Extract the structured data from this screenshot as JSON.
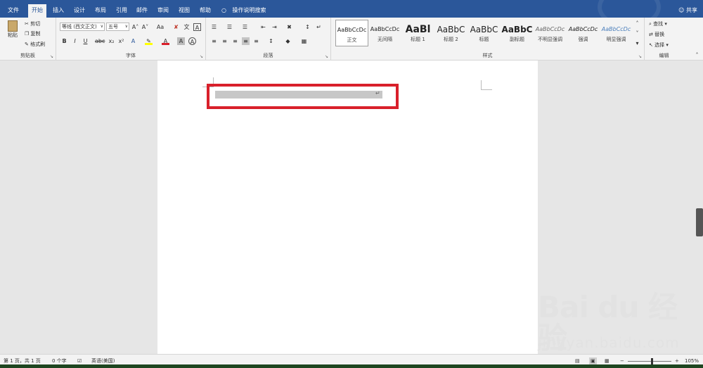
{
  "tabs": [
    "文件",
    "开始",
    "插入",
    "设计",
    "布局",
    "引用",
    "邮件",
    "审阅",
    "视图",
    "帮助"
  ],
  "active_tab": "开始",
  "tellme": "操作说明搜索",
  "share": "共享",
  "clipboard": {
    "paste": "粘贴",
    "cut": "剪切",
    "copy": "复制",
    "format_painter": "格式刷",
    "label": "剪贴板"
  },
  "font": {
    "name": "等线 (西文正文)",
    "size": "五号",
    "label": "字体",
    "icons": [
      "bold-icon",
      "italic-icon",
      "underline-icon",
      "strikethrough-icon",
      "subscript-icon",
      "superscript-icon"
    ]
  },
  "paragraph": {
    "label": "段落"
  },
  "styles": {
    "label": "样式",
    "items": [
      {
        "sample": "AaBbCcDc",
        "name": "正文"
      },
      {
        "sample": "AaBbCcDc",
        "name": "无间隔"
      },
      {
        "sample": "AaBl",
        "name": "标题 1"
      },
      {
        "sample": "AaBbC",
        "name": "标题 2"
      },
      {
        "sample": "AaBbC",
        "name": "标题"
      },
      {
        "sample": "AaBbC",
        "name": "副标题"
      },
      {
        "sample": "AaBbCcDc",
        "name": "不明显强调"
      },
      {
        "sample": "AaBbCcDc",
        "name": "强调"
      },
      {
        "sample": "AaBbCcDc",
        "name": "明显强调"
      }
    ]
  },
  "editing": {
    "find": "查找",
    "replace": "替换",
    "select": "选择",
    "label": "编辑"
  },
  "status": {
    "page": "第 1 页，共 1 页",
    "words": "0 个字",
    "language": "英语(美国)",
    "zoom": "105%"
  },
  "watermark": {
    "brand": "Bai du 经验",
    "url": "jingyan.baidu.com"
  },
  "colors": {
    "titlebar": "#2b579a",
    "highlight": "#d9202b",
    "selection": "#c7c7c7"
  }
}
